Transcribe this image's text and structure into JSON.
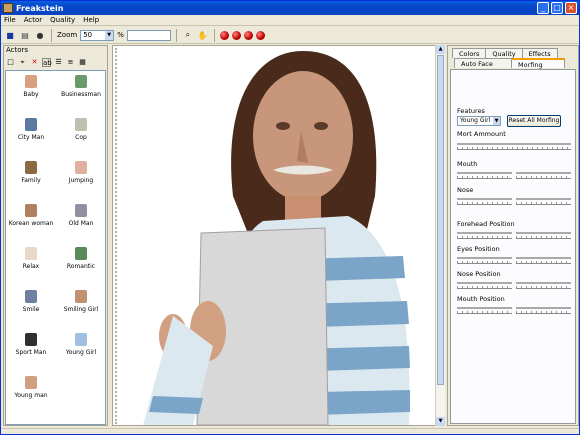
{
  "window": {
    "title": "Freakstein"
  },
  "menu": [
    "File",
    "Actor",
    "Quality",
    "Help"
  ],
  "toolbar": {
    "zoom_label": "Zoom",
    "zoom_value": "50",
    "pct": "%"
  },
  "actors": {
    "header": "Actors",
    "items": [
      "Baby",
      "Businessman",
      "City Man",
      "Cop",
      "Family",
      "Jumping",
      "Korean woman",
      "Old Man",
      "Relax",
      "Romantic",
      "Smile",
      "Smiling Girl",
      "Sport Man",
      "Young Girl",
      "Young man"
    ]
  },
  "tabs": {
    "row1": [
      "Colors",
      "Quality",
      "Effects"
    ],
    "row2": [
      "Auto Face",
      "Morfing"
    ],
    "selected": "Morfing"
  },
  "morph": {
    "features_label": "Features",
    "feature_value": "Young Girl",
    "reset_button": "Reset All Morfing",
    "mort_amount": "Mort Ammount",
    "mouth": "Mouth",
    "nose": "Nose",
    "forehead": "Forehead Position",
    "eyes": "Eyes Position",
    "nose_pos": "Nose Position",
    "mouth_pos": "Mouth Position"
  },
  "colors": {
    "titlebar": "#0447c8",
    "face_bg": "#ece9d8",
    "accent": "#f0a000"
  }
}
